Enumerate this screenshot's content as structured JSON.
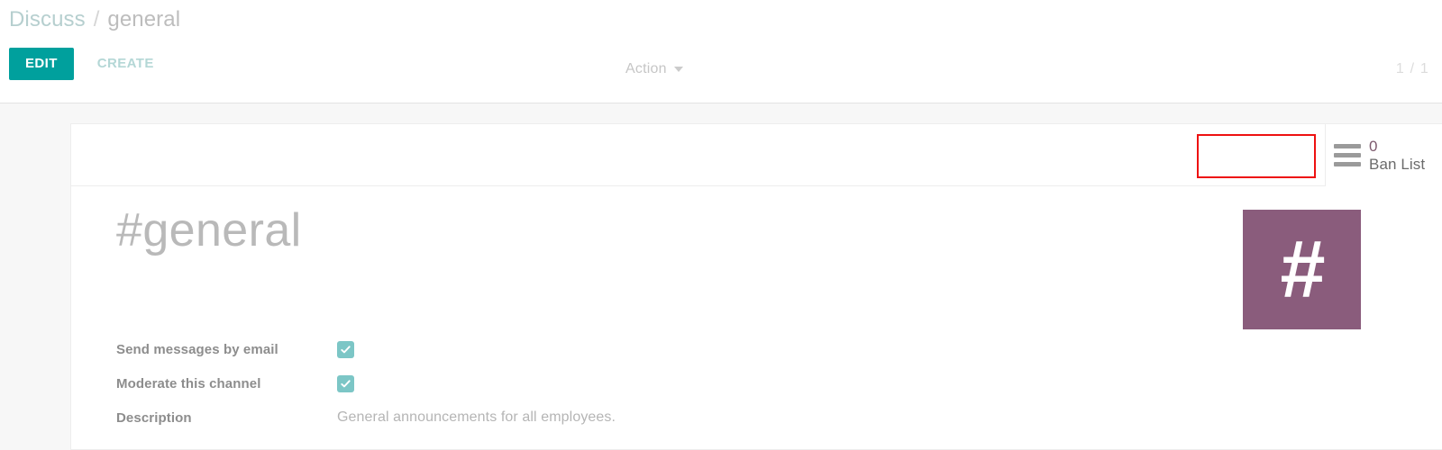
{
  "breadcrumb": {
    "root": "Discuss",
    "separator": "/",
    "current": "general"
  },
  "control_panel": {
    "edit_label": "EDIT",
    "create_label": "CREATE",
    "action_label": "Action",
    "action_caret_icon": "chevron-down-icon",
    "pager": "1 / 1"
  },
  "button_box": {
    "stat_buttons": [
      {
        "icon": "bars-list-icon",
        "value": "0",
        "label": "Ban List"
      }
    ],
    "annotation": {
      "type": "highlight-rectangle",
      "color": "#ee1111"
    }
  },
  "record": {
    "title": "#general",
    "avatar_glyph": "#",
    "avatar_color": "#8a5c7c"
  },
  "fields": [
    {
      "label": "Send messages by email",
      "type": "checkbox",
      "checked": true,
      "value": ""
    },
    {
      "label": "Moderate this channel",
      "type": "checkbox",
      "checked": true,
      "value": ""
    },
    {
      "label": "Description",
      "type": "text",
      "checked": false,
      "value": "General announcements for all employees."
    }
  ],
  "colors": {
    "accent_teal": "#00a09d",
    "checkbox_teal": "#7cc6c6",
    "avatar_purple": "#8a5c7c",
    "stat_value": "#7d5a6e",
    "annotation_red": "#ee1111"
  }
}
